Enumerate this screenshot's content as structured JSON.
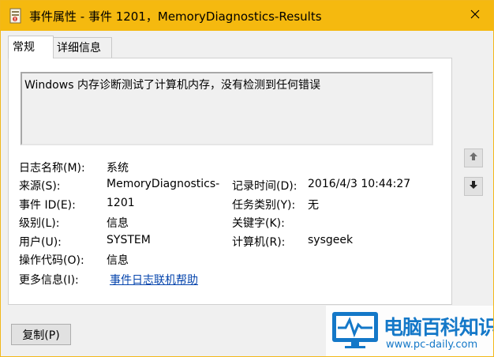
{
  "window": {
    "title": "事件属性 - 事件 1201，MemoryDiagnostics-Results"
  },
  "tabs": [
    {
      "label": "常规"
    },
    {
      "label": "详细信息"
    }
  ],
  "description": "Windows 内存诊断测试了计算机内存，没有检测到任何错误",
  "fields": {
    "log_name": {
      "label": "日志名称(M):",
      "value": "系统"
    },
    "source": {
      "label": "来源(S):",
      "value": "MemoryDiagnostics-"
    },
    "logged": {
      "label": "记录时间(D):",
      "value": "2016/4/3 10:44:27"
    },
    "event_id": {
      "label": "事件 ID(E):",
      "value": "1201"
    },
    "task_category": {
      "label": "任务类别(Y):",
      "value": "无"
    },
    "level": {
      "label": "级别(L):",
      "value": "信息"
    },
    "keywords": {
      "label": "关键字(K):",
      "value": ""
    },
    "user": {
      "label": "用户(U):",
      "value": "SYSTEM"
    },
    "computer": {
      "label": "计算机(R):",
      "value": "sysgeek"
    },
    "opcode": {
      "label": "操作代码(O):",
      "value": "信息"
    },
    "more_info": {
      "label": "更多信息(I):",
      "value": "事件日志联机帮助"
    }
  },
  "buttons": {
    "copy": "复制(P)"
  },
  "watermark": {
    "title": "电脑百科知识",
    "url": "www.pc-daily.com"
  },
  "colors": {
    "titlebar": "#f5b90f",
    "link": "#0645ad",
    "watermark": "#1478c8"
  },
  "icons": {
    "app": "event-properties-icon",
    "close": "close-icon",
    "up": "arrow-up-icon",
    "down": "arrow-down-icon"
  }
}
